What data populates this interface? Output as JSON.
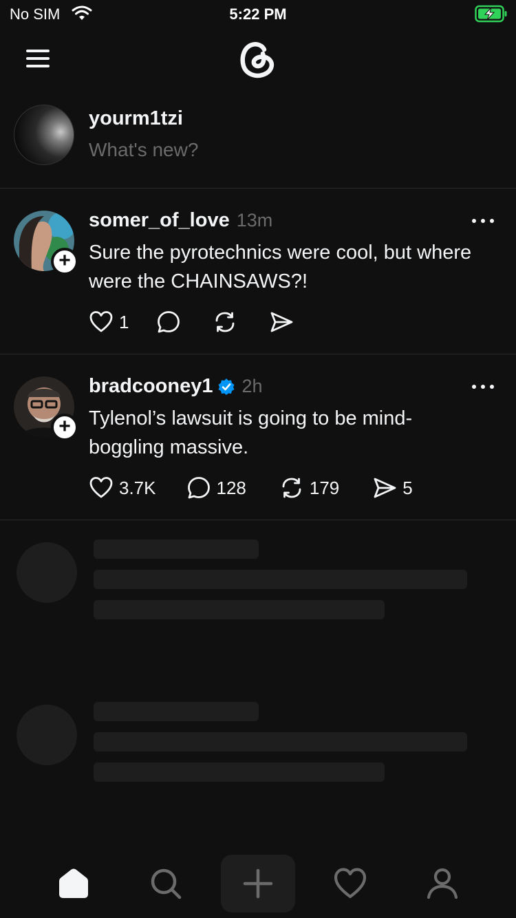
{
  "status_bar": {
    "carrier": "No SIM",
    "time": "5:22 PM",
    "battery_color": "#30d158"
  },
  "header": {
    "menu_icon": "menu-icon",
    "logo_icon": "threads-logo-icon"
  },
  "composer": {
    "username": "yourm1tzi",
    "placeholder": "What's new?"
  },
  "posts": [
    {
      "username": "somer_of_love",
      "verified": false,
      "time": "13m",
      "text": "Sure the pyrotechnics were cool, but where were the CHAINSAWS?!",
      "likes": "1",
      "replies": "",
      "reposts": "",
      "shares": ""
    },
    {
      "username": "bradcooney1",
      "verified": true,
      "time": "2h",
      "text": "Tylenol’s lawsuit is going to be mind-boggling massive.",
      "likes": "3.7K",
      "replies": "128",
      "reposts": "179",
      "shares": "5"
    }
  ],
  "colors": {
    "background": "#101010",
    "text": "#f3f5f7",
    "muted": "#6b6b6b",
    "divider": "#2a2a2a",
    "skeleton": "#1e1e1e",
    "verified": "#0095f6"
  },
  "tab_bar": {
    "tabs": [
      "home-icon",
      "search-icon",
      "compose-icon",
      "activity-heart-icon",
      "profile-icon"
    ],
    "active": "home-icon"
  }
}
